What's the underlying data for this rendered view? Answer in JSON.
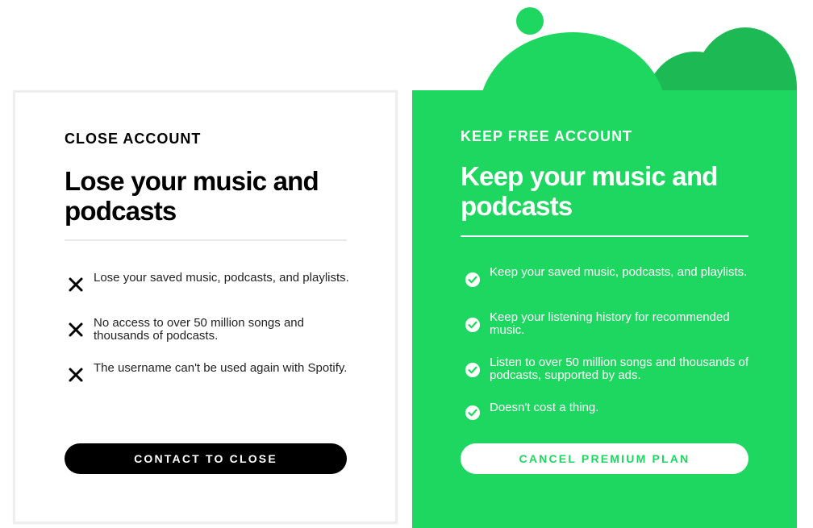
{
  "close_account": {
    "eyebrow": "CLOSE ACCOUNT",
    "title": "Lose your music and podcasts",
    "features": [
      {
        "text": "Lose your saved music, podcasts, and playlists.",
        "icon": "x-icon"
      },
      {
        "text": "No access to over 50 million songs and thousands of podcasts.",
        "icon": "x-icon"
      },
      {
        "text": "The username can't be used again with Spotify.",
        "icon": "x-icon"
      }
    ],
    "button_label": "CONTACT TO CLOSE"
  },
  "keep_free_account": {
    "eyebrow": "KEEP FREE ACCOUNT",
    "title": "Keep your music and podcasts",
    "features": [
      {
        "text": "Keep your saved music, podcasts, and playlists.",
        "icon": "check-circle-icon"
      },
      {
        "text": "Keep your listening history for recommended music.",
        "icon": "check-circle-icon"
      },
      {
        "text": "Listen to over 50 million songs and thousands of podcasts, supported by ads.",
        "icon": "check-circle-icon"
      },
      {
        "text": "Doesn't cost a thing.",
        "icon": "check-circle-icon"
      }
    ],
    "button_label": "CANCEL PREMIUM PLAN"
  },
  "colors": {
    "brand_green": "#1ed760",
    "dark_green": "#1db954",
    "black": "#000000",
    "white": "#ffffff"
  }
}
